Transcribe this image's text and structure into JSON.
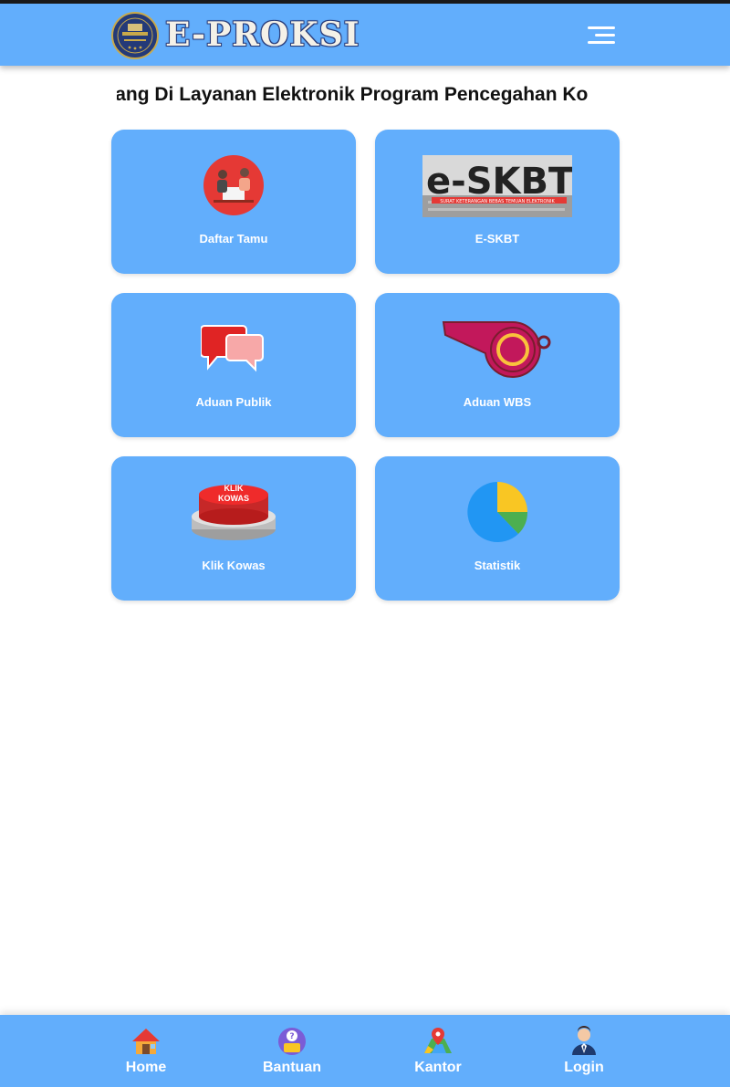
{
  "header": {
    "app_title": "E-PROKSI",
    "logo_name": "emblem-logo-icon",
    "menu_icon": "hamburger-menu-icon"
  },
  "welcome": {
    "marquee_text": "Selamat Datang Di Layanan Elektronik Program Pencegahan Ko"
  },
  "tiles": [
    {
      "label": "Daftar Tamu",
      "icon": "guest-meeting-icon"
    },
    {
      "label": "E-SKBT",
      "icon": "e-skbt-banner-icon",
      "banner_text": "e-SKBT",
      "banner_subtext": "SURAT KETERANGAN BEBAS TEMUAN ELEKTRONIK"
    },
    {
      "label": "Aduan Publik",
      "icon": "chat-bubbles-icon"
    },
    {
      "label": "Aduan WBS",
      "icon": "whistle-icon"
    },
    {
      "label": "Klik Kowas",
      "icon": "red-button-icon",
      "button_text_1": "KLIK",
      "button_text_2": "KOWAS"
    },
    {
      "label": "Statistik",
      "icon": "pie-chart-icon"
    }
  ],
  "bottom_nav": [
    {
      "label": "Home",
      "icon": "home-icon"
    },
    {
      "label": "Bantuan",
      "icon": "help-icon"
    },
    {
      "label": "Kantor",
      "icon": "map-location-icon"
    },
    {
      "label": "Login",
      "icon": "user-icon"
    }
  ],
  "colors": {
    "primary": "#62aefc",
    "text_dark": "#111111",
    "tile_label": "#ffffff"
  }
}
